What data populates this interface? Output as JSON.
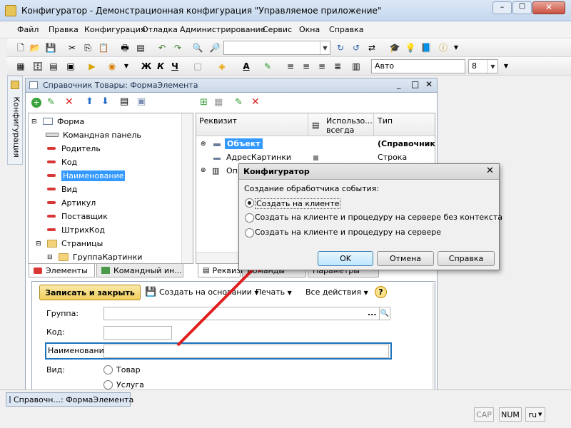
{
  "window": {
    "title": "Конфигуратор - Демонстрационная конфигурация \"Управляемое приложение\""
  },
  "menu": [
    "Файл",
    "Правка",
    "Конфигурация",
    "Отладка",
    "Администрирование",
    "Сервис",
    "Окна",
    "Справка"
  ],
  "toolbar2": {
    "font_value": "Авто",
    "size_value": "8"
  },
  "side_panel": {
    "label": "Конфигурация"
  },
  "form": {
    "title": "Справочник Товары: ФормаЭлемента",
    "tree": [
      "Форма",
      "Командная панель",
      "Родитель",
      "Код",
      "Наименование",
      "Вид",
      "Артикул",
      "Поставщик",
      "ШтрихКод",
      "Страницы",
      "ГруппаКартинки"
    ],
    "tree_selected": 4,
    "left_tabs": [
      "Элементы",
      "Командный ин..."
    ],
    "right_tabs": [
      "Реквизи...",
      "Команды",
      "Параметры"
    ],
    "props_headers": [
      "Реквизит",
      "Использо... всегда",
      "Тип"
    ],
    "props_rows": [
      {
        "name": "Объект",
        "type": "(СправочникОб"
      },
      {
        "name": "АдресКартинки",
        "type": "Строка"
      },
      {
        "name": "Опи",
        "type": ""
      }
    ]
  },
  "preview": {
    "save_button": "Записать и закрыть",
    "create_basis": "Создать на основании",
    "print": "Печать",
    "all_actions": "Все действия",
    "help": "?",
    "labels": {
      "group": "Группа:",
      "code": "Код:",
      "name": "Наименование:",
      "kind": "Вид:"
    },
    "radio_options": [
      "Товар",
      "Услуга"
    ],
    "lookup_button": "..."
  },
  "dialog": {
    "title": "Конфигуратор",
    "prompt": "Создание обработчика события:",
    "options": [
      "Создать на клиенте",
      "Создать на клиенте и процедуру на сервере без контекста",
      "Создать на клиенте и процедуру на сервере"
    ],
    "selected": 0,
    "buttons": {
      "ok": "OK",
      "cancel": "Отмена",
      "help": "Справка"
    }
  },
  "statusbar": {
    "window_tab": "Справочн...: ФормаЭлемента",
    "cap": "CAP",
    "num": "NUM",
    "lang": "ru"
  },
  "colors": {
    "arrow": "#e01e1e",
    "selection": "#3399ff",
    "accent": "#1e73be"
  }
}
